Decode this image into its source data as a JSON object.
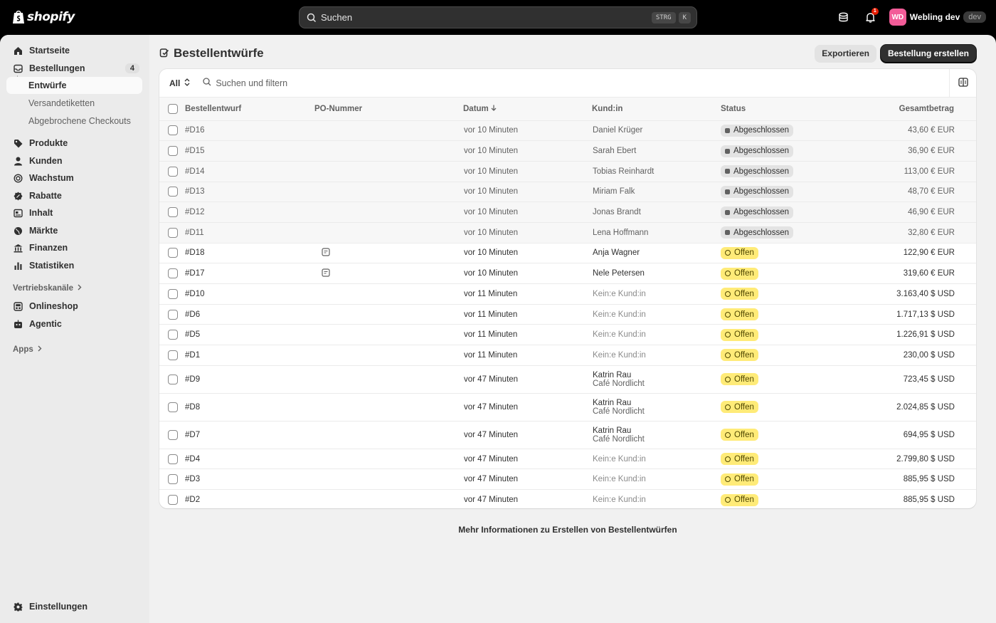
{
  "topbar": {
    "brand": "shopify",
    "search_placeholder": "Suchen",
    "shortcut_key1": "STRG",
    "shortcut_key2": "K",
    "notification_count": "1",
    "avatar_initials": "WD",
    "store_name": "Webling dev",
    "env_badge": "dev"
  },
  "sidebar": {
    "home": "Startseite",
    "orders": "Bestellungen",
    "orders_count": "4",
    "drafts": "Entwürfe",
    "shipping_labels": "Versandetiketten",
    "abandoned": "Abgebrochene Checkouts",
    "products": "Produkte",
    "customers": "Kunden",
    "growth": "Wachstum",
    "discounts": "Rabatte",
    "content": "Inhalt",
    "markets": "Märkte",
    "finance": "Finanzen",
    "analytics": "Statistiken",
    "sales_channels": "Vertriebskanäle",
    "online_store": "Onlineshop",
    "agentic": "Agentic",
    "apps": "Apps",
    "settings": "Einstellungen"
  },
  "page": {
    "title": "Bestellentwürfe",
    "export_label": "Exportieren",
    "create_label": "Bestellung erstellen",
    "filter_all": "All",
    "filter_placeholder": "Suchen und filtern",
    "footer_link": "Mehr Informationen zu Erstellen von Bestellentwürfen"
  },
  "table": {
    "headers": {
      "draft": "Bestellentwurf",
      "po": "PO-Nummer",
      "date": "Datum",
      "customer": "Kund:in",
      "status": "Status",
      "total": "Gesamtbetrag"
    },
    "rows": [
      {
        "id": "#D16",
        "note": false,
        "date": "vor 10 Minuten",
        "customer": "Daniel Krüger",
        "company": "",
        "status": "Abgeschlossen",
        "state": "closed",
        "total": "43,60 € EUR"
      },
      {
        "id": "#D15",
        "note": false,
        "date": "vor 10 Minuten",
        "customer": "Sarah Ebert",
        "company": "",
        "status": "Abgeschlossen",
        "state": "closed",
        "total": "36,90 € EUR"
      },
      {
        "id": "#D14",
        "note": false,
        "date": "vor 10 Minuten",
        "customer": "Tobias Reinhardt",
        "company": "",
        "status": "Abgeschlossen",
        "state": "closed",
        "total": "113,00 € EUR"
      },
      {
        "id": "#D13",
        "note": false,
        "date": "vor 10 Minuten",
        "customer": "Miriam Falk",
        "company": "",
        "status": "Abgeschlossen",
        "state": "closed",
        "total": "48,70 € EUR"
      },
      {
        "id": "#D12",
        "note": false,
        "date": "vor 10 Minuten",
        "customer": "Jonas Brandt",
        "company": "",
        "status": "Abgeschlossen",
        "state": "closed",
        "total": "46,90 € EUR"
      },
      {
        "id": "#D11",
        "note": false,
        "date": "vor 10 Minuten",
        "customer": "Lena Hoffmann",
        "company": "",
        "status": "Abgeschlossen",
        "state": "closed",
        "total": "32,80 € EUR"
      },
      {
        "id": "#D18",
        "note": true,
        "date": "vor 10 Minuten",
        "customer": "Anja Wagner",
        "company": "",
        "status": "Offen",
        "state": "open",
        "total": "122,90 € EUR"
      },
      {
        "id": "#D17",
        "note": true,
        "date": "vor 10 Minuten",
        "customer": "Nele Petersen",
        "company": "",
        "status": "Offen",
        "state": "open",
        "total": "319,60 € EUR"
      },
      {
        "id": "#D10",
        "note": false,
        "date": "vor 11 Minuten",
        "customer": "Kein:e Kund:in",
        "company": "",
        "status": "Offen",
        "state": "open",
        "total": "3.163,40 $ USD",
        "nocust": true
      },
      {
        "id": "#D6",
        "note": false,
        "date": "vor 11 Minuten",
        "customer": "Kein:e Kund:in",
        "company": "",
        "status": "Offen",
        "state": "open",
        "total": "1.717,13 $ USD",
        "nocust": true
      },
      {
        "id": "#D5",
        "note": false,
        "date": "vor 11 Minuten",
        "customer": "Kein:e Kund:in",
        "company": "",
        "status": "Offen",
        "state": "open",
        "total": "1.226,91 $ USD",
        "nocust": true
      },
      {
        "id": "#D1",
        "note": false,
        "date": "vor 11 Minuten",
        "customer": "Kein:e Kund:in",
        "company": "",
        "status": "Offen",
        "state": "open",
        "total": "230,00 $ USD",
        "nocust": true
      },
      {
        "id": "#D9",
        "note": false,
        "date": "vor 47 Minuten",
        "customer": "Katrin Rau",
        "company": "Café Nordlicht",
        "status": "Offen",
        "state": "open",
        "total": "723,45 $ USD"
      },
      {
        "id": "#D8",
        "note": false,
        "date": "vor 47 Minuten",
        "customer": "Katrin Rau",
        "company": "Café Nordlicht",
        "status": "Offen",
        "state": "open",
        "total": "2.024,85 $ USD"
      },
      {
        "id": "#D7",
        "note": false,
        "date": "vor 47 Minuten",
        "customer": "Katrin Rau",
        "company": "Café Nordlicht",
        "status": "Offen",
        "state": "open",
        "total": "694,95 $ USD"
      },
      {
        "id": "#D4",
        "note": false,
        "date": "vor 47 Minuten",
        "customer": "Kein:e Kund:in",
        "company": "",
        "status": "Offen",
        "state": "open",
        "total": "2.799,80 $ USD",
        "nocust": true
      },
      {
        "id": "#D3",
        "note": false,
        "date": "vor 47 Minuten",
        "customer": "Kein:e Kund:in",
        "company": "",
        "status": "Offen",
        "state": "open",
        "total": "885,95 $ USD",
        "nocust": true
      },
      {
        "id": "#D2",
        "note": false,
        "date": "vor 47 Minuten",
        "customer": "Kein:e Kund:in",
        "company": "",
        "status": "Offen",
        "state": "open",
        "total": "885,95 $ USD",
        "nocust": true
      }
    ]
  },
  "colors": {
    "open_badge": "#ffeb78",
    "closed_badge": "#e3e3e3",
    "primary_button": "#303030",
    "avatar": "#f25c98"
  }
}
